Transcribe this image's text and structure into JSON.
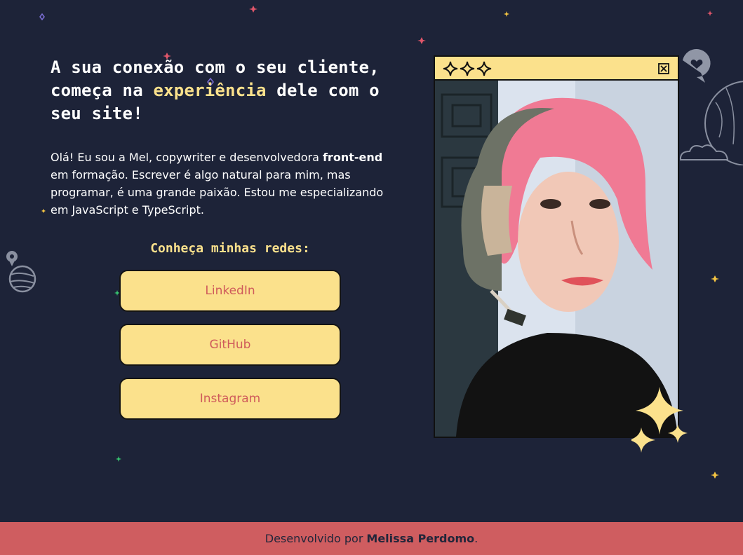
{
  "hero": {
    "headline_part1": "A sua conexão com o seu cliente, começa na ",
    "headline_highlight": "experiência",
    "headline_part2": " dele com o seu site!",
    "intro_part1": "Olá! Eu sou a Mel, copywriter e desenvolvedora ",
    "intro_bold": "front-end",
    "intro_part2": " em formação. Escrever é algo natural para mim, mas programar, é uma grande paixão. Estou me especializando em JavaScript e TypeScript."
  },
  "social": {
    "heading": "Conheça minhas redes:",
    "buttons": [
      {
        "label": "LinkedIn"
      },
      {
        "label": "GitHub"
      },
      {
        "label": "Instagram"
      }
    ]
  },
  "photo_window": {
    "title_icons": "sparkle-icons",
    "close_icon": "close-icon"
  },
  "footer": {
    "prefix": "Desenvolvido por",
    "author": "Melissa Perdomo",
    "suffix": "."
  },
  "colors": {
    "background": "#1d2338",
    "accent_yellow": "#fbe18c",
    "accent_red": "#cf5d60",
    "button_text": "#cf5b5b"
  }
}
